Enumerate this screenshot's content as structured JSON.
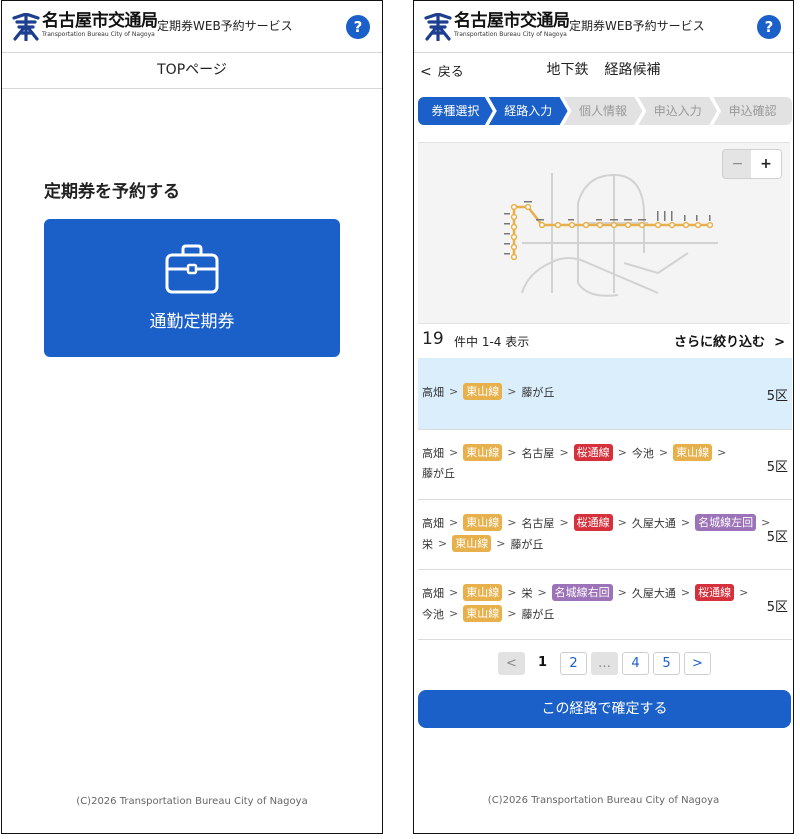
{
  "brand": {
    "name": "名古屋市交通局",
    "name_en": "Transportation Bureau City of Nagoya",
    "service": "定期券WEB予約サービス",
    "help": "?"
  },
  "left": {
    "subbar_title": "TOPページ",
    "heading": "定期券を予約する",
    "commute_button": "通勤定期券",
    "footer": "(C)2026 Transportation Bureau City of Nagoya"
  },
  "right": {
    "back_chevron": "<",
    "back_label": "戻る",
    "title_mode": "地下鉄",
    "title_page": "経路候補",
    "steps": [
      "券種選択",
      "経路入力",
      "個人情報",
      "申込入力",
      "申込確認"
    ],
    "steps_done": 2,
    "zoom": {
      "minus": "−",
      "plus": "+"
    },
    "count": "19",
    "count_text": "件中 1-4 表示",
    "refine": "さらに絞り込む",
    "refine_chevron": ">",
    "routes": [
      {
        "lines": [
          [
            {
              "t": "station",
              "v": "高畑"
            },
            {
              "t": "line",
              "v": "東山線",
              "c": "#e8b04b"
            },
            {
              "t": "station",
              "v": "藤が丘"
            }
          ]
        ],
        "zone": "5区",
        "selected": true
      },
      {
        "lines": [
          [
            {
              "t": "station",
              "v": "高畑"
            },
            {
              "t": "line",
              "v": "東山線",
              "c": "#e8b04b"
            },
            {
              "t": "station",
              "v": "名古屋"
            },
            {
              "t": "line",
              "v": "桜通線",
              "c": "#d6303c"
            },
            {
              "t": "station",
              "v": "今池"
            },
            {
              "t": "line",
              "v": "東山線",
              "c": "#e8b04b"
            }
          ],
          [
            {
              "t": "station",
              "v": "藤が丘"
            }
          ]
        ],
        "zone": "5区",
        "selected": false
      },
      {
        "lines": [
          [
            {
              "t": "station",
              "v": "高畑"
            },
            {
              "t": "line",
              "v": "東山線",
              "c": "#e8b04b"
            },
            {
              "t": "station",
              "v": "名古屋"
            },
            {
              "t": "line",
              "v": "桜通線",
              "c": "#d6303c"
            },
            {
              "t": "station",
              "v": "久屋大通"
            },
            {
              "t": "line",
              "v": "名城線左回",
              "c": "#9c72b8"
            }
          ],
          [
            {
              "t": "station",
              "v": "栄"
            },
            {
              "t": "line",
              "v": "東山線",
              "c": "#e8b04b"
            },
            {
              "t": "station",
              "v": "藤が丘"
            }
          ]
        ],
        "zone": "5区",
        "selected": false
      },
      {
        "lines": [
          [
            {
              "t": "station",
              "v": "高畑"
            },
            {
              "t": "line",
              "v": "東山線",
              "c": "#e8b04b"
            },
            {
              "t": "station",
              "v": "栄"
            },
            {
              "t": "line",
              "v": "名城線右回",
              "c": "#9c72b8"
            },
            {
              "t": "station",
              "v": "久屋大通"
            },
            {
              "t": "line",
              "v": "桜通線",
              "c": "#d6303c"
            }
          ],
          [
            {
              "t": "station",
              "v": "今池"
            },
            {
              "t": "line",
              "v": "東山線",
              "c": "#e8b04b"
            },
            {
              "t": "station",
              "v": "藤が丘"
            }
          ]
        ],
        "zone": "5区",
        "selected": false
      }
    ],
    "pager": [
      {
        "label": "<",
        "state": "disabled"
      },
      {
        "label": "1",
        "state": "current"
      },
      {
        "label": "2",
        "state": "link"
      },
      {
        "label": "…",
        "state": "disabled"
      },
      {
        "label": "4",
        "state": "link"
      },
      {
        "label": "5",
        "state": "link"
      },
      {
        "label": ">",
        "state": "link"
      }
    ],
    "confirm": "この経路で確定する",
    "footer": "(C)2026 Transportation Bureau City of Nagoya"
  },
  "colors": {
    "primary": "#1b5fc9",
    "higashiyama": "#e8b04b",
    "sakuradori": "#d6303c",
    "meijo": "#9c72b8",
    "selected_row": "#dbeefb"
  }
}
